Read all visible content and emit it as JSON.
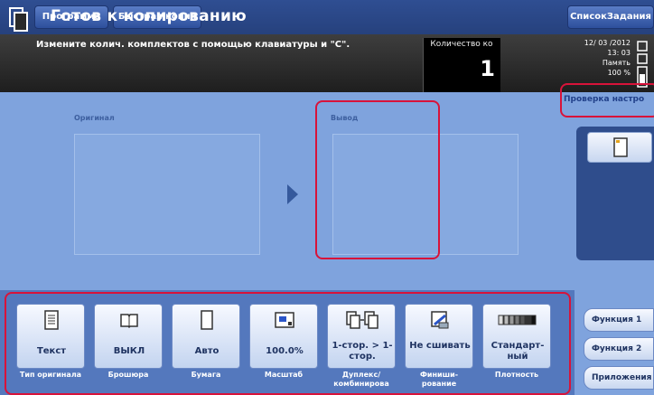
{
  "topbar": {
    "program_label": "Программа",
    "quick_copy_label": "Быстрая копия",
    "job_list_label": "СписокЗадания"
  },
  "status": {
    "title": "Готов к копированию",
    "message": "Измените колич. комплектов с помощью клавиатуры и \"С\".",
    "quantity_label": "Количество ко",
    "quantity_value": "1",
    "date": "12/ 03 /2012",
    "time": "13: 03",
    "memory_label": "Память",
    "memory_value": "100 %"
  },
  "preview": {
    "original_label": "Оригинал",
    "output_label": "Вывод"
  },
  "side": {
    "check_settings_label": "Проверка настро"
  },
  "functions": [
    {
      "icon": "text-document-icon",
      "value": "Текст",
      "caption": "Тип оригинала"
    },
    {
      "icon": "booklet-icon",
      "value": "ВЫКЛ",
      "caption": "Брошюра"
    },
    {
      "icon": "paper-icon",
      "value": "Авто",
      "caption": "Бумага"
    },
    {
      "icon": "zoom-icon",
      "value": "100.0%",
      "caption": "Масштаб"
    },
    {
      "icon": "duplex-icon",
      "value": "1-стор. > 1-стор.",
      "caption": "Дуплекс/ комбинирова"
    },
    {
      "icon": "staple-icon",
      "value": "Не сшивать",
      "caption": "Финиши- рование"
    },
    {
      "icon": "density-icon",
      "value": "Стандарт- ный",
      "caption": "Плотность"
    }
  ],
  "tabs": {
    "function1_label": "Функция 1",
    "function2_label": "Функция 2",
    "applications_label": "Приложения"
  },
  "colors": {
    "highlight": "#d8133a",
    "panel_blue": "#7fa3dd",
    "topbar_blue": "#2f4e92"
  }
}
